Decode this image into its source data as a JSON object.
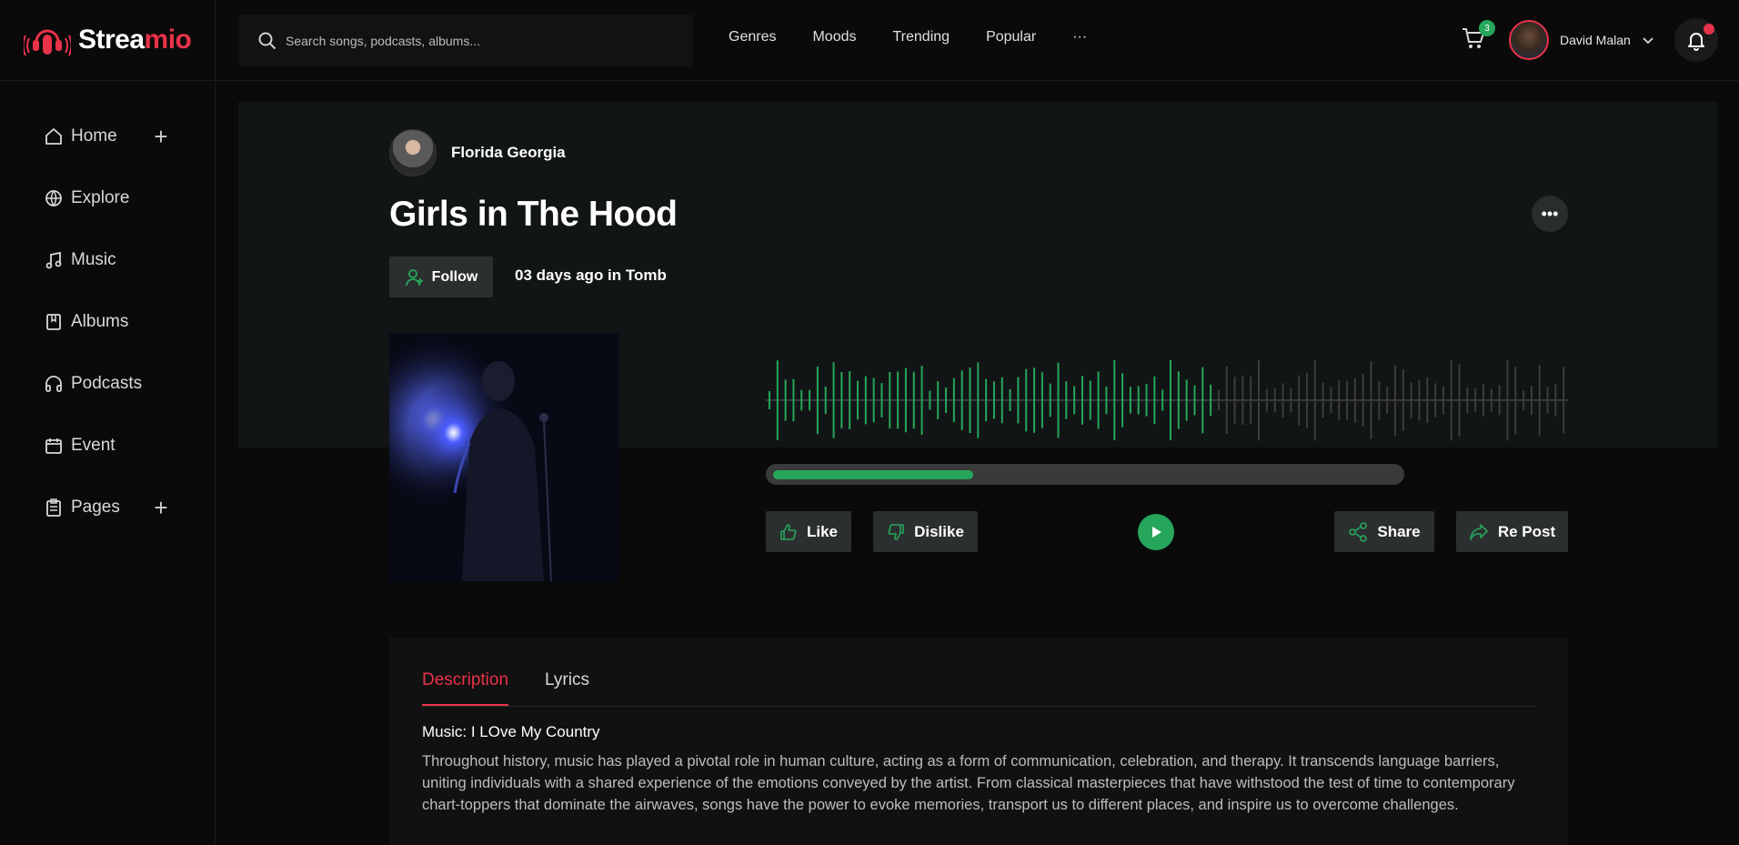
{
  "brand": {
    "name_prefix": "Strea",
    "name_suffix": "mio",
    "accent_color": "#e8324a",
    "play_color": "#26a65b"
  },
  "search": {
    "placeholder": "Search songs, podcasts, albums..."
  },
  "topnav": {
    "items": [
      "Genres",
      "Moods",
      "Trending",
      "Popular",
      "···"
    ]
  },
  "cart": {
    "count": "3"
  },
  "user": {
    "name": "David Malan"
  },
  "sidebar": {
    "items": [
      {
        "label": "Home",
        "icon": "home-icon",
        "expandable": true
      },
      {
        "label": "Explore",
        "icon": "globe-icon",
        "expandable": false
      },
      {
        "label": "Music",
        "icon": "music-note-icon",
        "expandable": false
      },
      {
        "label": "Albums",
        "icon": "album-icon",
        "expandable": false
      },
      {
        "label": "Podcasts",
        "icon": "headphones-icon",
        "expandable": false
      },
      {
        "label": "Event",
        "icon": "calendar-icon",
        "expandable": false
      },
      {
        "label": "Pages",
        "icon": "clipboard-icon",
        "expandable": true
      }
    ]
  },
  "track": {
    "artist": "Florida Georgia",
    "title": "Girls in The Hood",
    "follow_label": "Follow",
    "posted": "03 days ago in Tomb",
    "progress": 0.32,
    "waveform_played_fraction": 0.56
  },
  "actions": {
    "like": "Like",
    "dislike": "Dislike",
    "share": "Share",
    "repost": "Re Post"
  },
  "description": {
    "tabs": [
      "Description",
      "Lyrics"
    ],
    "heading": "Music: I LOve My Country",
    "body": "Throughout history, music has played a pivotal role in human culture, acting as a form of communication, celebration, and therapy. It transcends language barriers, uniting individuals with a shared experience of the emotions conveyed by the artist. From classical masterpieces that have withstood the test of time to contemporary chart-toppers that dominate the airwaves, songs have the power to evoke memories, transport us to different places, and inspire us to overcome challenges."
  }
}
